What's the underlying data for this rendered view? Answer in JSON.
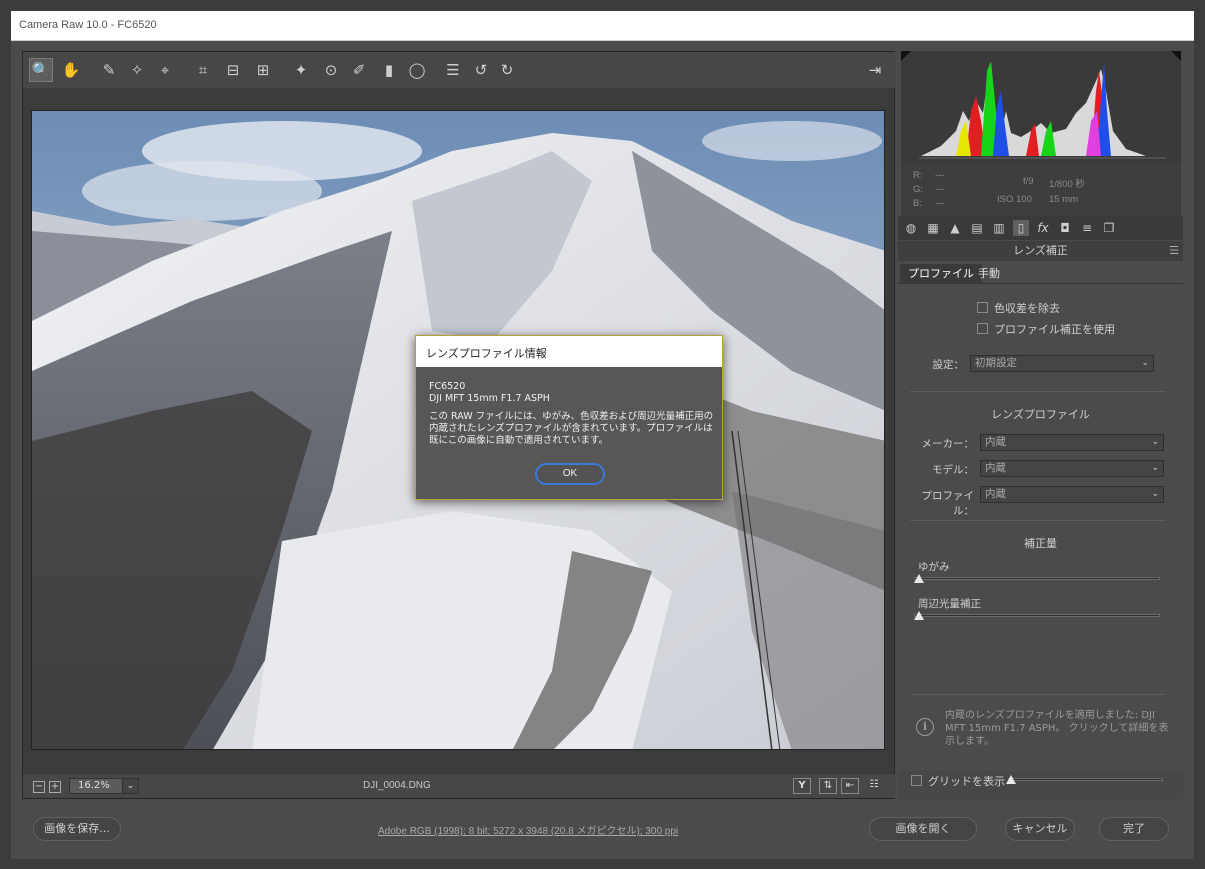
{
  "window": {
    "title": "Camera Raw 10.0  -  FC6520"
  },
  "toolbar": {
    "tools": [
      {
        "name": "zoom-tool-icon",
        "glyph": "🔍"
      },
      {
        "name": "hand-tool-icon",
        "glyph": "✋"
      },
      {
        "name": "white-balance-tool-icon",
        "glyph": "✎"
      },
      {
        "name": "color-sampler-tool-icon",
        "glyph": "✧"
      },
      {
        "name": "targeted-adjustment-tool-icon",
        "glyph": "⌖"
      },
      {
        "name": "crop-tool-icon",
        "glyph": "⌗"
      },
      {
        "name": "straighten-tool-icon",
        "glyph": "⊟"
      },
      {
        "name": "transform-tool-icon",
        "glyph": "⊞"
      },
      {
        "name": "spot-removal-tool-icon",
        "glyph": "✦"
      },
      {
        "name": "red-eye-tool-icon",
        "glyph": "⊙"
      },
      {
        "name": "adjustment-brush-icon",
        "glyph": "✐"
      },
      {
        "name": "graduated-filter-icon",
        "glyph": "▮"
      },
      {
        "name": "radial-filter-icon",
        "glyph": "◯"
      },
      {
        "name": "preferences-icon",
        "glyph": "☰"
      },
      {
        "name": "rotate-left-icon",
        "glyph": "↺"
      },
      {
        "name": "rotate-right-icon",
        "glyph": "↻"
      }
    ],
    "export_icon": "⇥"
  },
  "bottom_bar": {
    "zoom": "16.2%",
    "filename": "DJI_0004.DNG"
  },
  "dialog": {
    "title": "レンズプロファイル情報",
    "line1": "FC6520",
    "line2": "DJI MFT 15mm F1.7 ASPH",
    "message": "この RAW ファイルには、ゆがみ、色収差および周辺光量補正用の内蔵されたレンズプロファイルが含まれています。プロファイルは既にこの画像に自動で適用されています。",
    "ok": "OK"
  },
  "info": {
    "r": "R:",
    "g": "G:",
    "b": "B:",
    "r_val": "---",
    "g_val": "---",
    "b_val": "---",
    "aperture": "f/9",
    "shutter": "1/800 秒",
    "iso": "ISO 100",
    "focal": "15 mm"
  },
  "panel": {
    "title": "レンズ補正",
    "tab_profile": "プロファイル",
    "tab_manual": "手動",
    "remove_ca": "色収差を除去",
    "use_profile": "プロファイル補正を使用",
    "setup_label": "設定：",
    "setup_value": "初期設定",
    "lens_profile_heading": "レンズプロファイル",
    "maker_label": "メーカー：",
    "maker_value": "内蔵",
    "model_label": "モデル：",
    "model_value": "内蔵",
    "profile_label": "プロファイル：",
    "profile_value": "内蔵",
    "amount_heading": "補正量",
    "distortion_label": "ゆがみ",
    "vignetting_label": "周辺光量補正",
    "note": "内蔵のレンズプロファイルを適用しました: DJI MFT 15mm F1.7 ASPH。 クリックして詳細を表示します。",
    "grid_label": "グリッドを表示"
  },
  "footer": {
    "save": "画像を保存...",
    "info_link": "Adobe RGB (1998); 8 bit; 5272 x 3948 (20.8 メガピクセル); 300 ppi",
    "open": "画像を開く",
    "cancel": "キャンセル",
    "done": "完了"
  }
}
